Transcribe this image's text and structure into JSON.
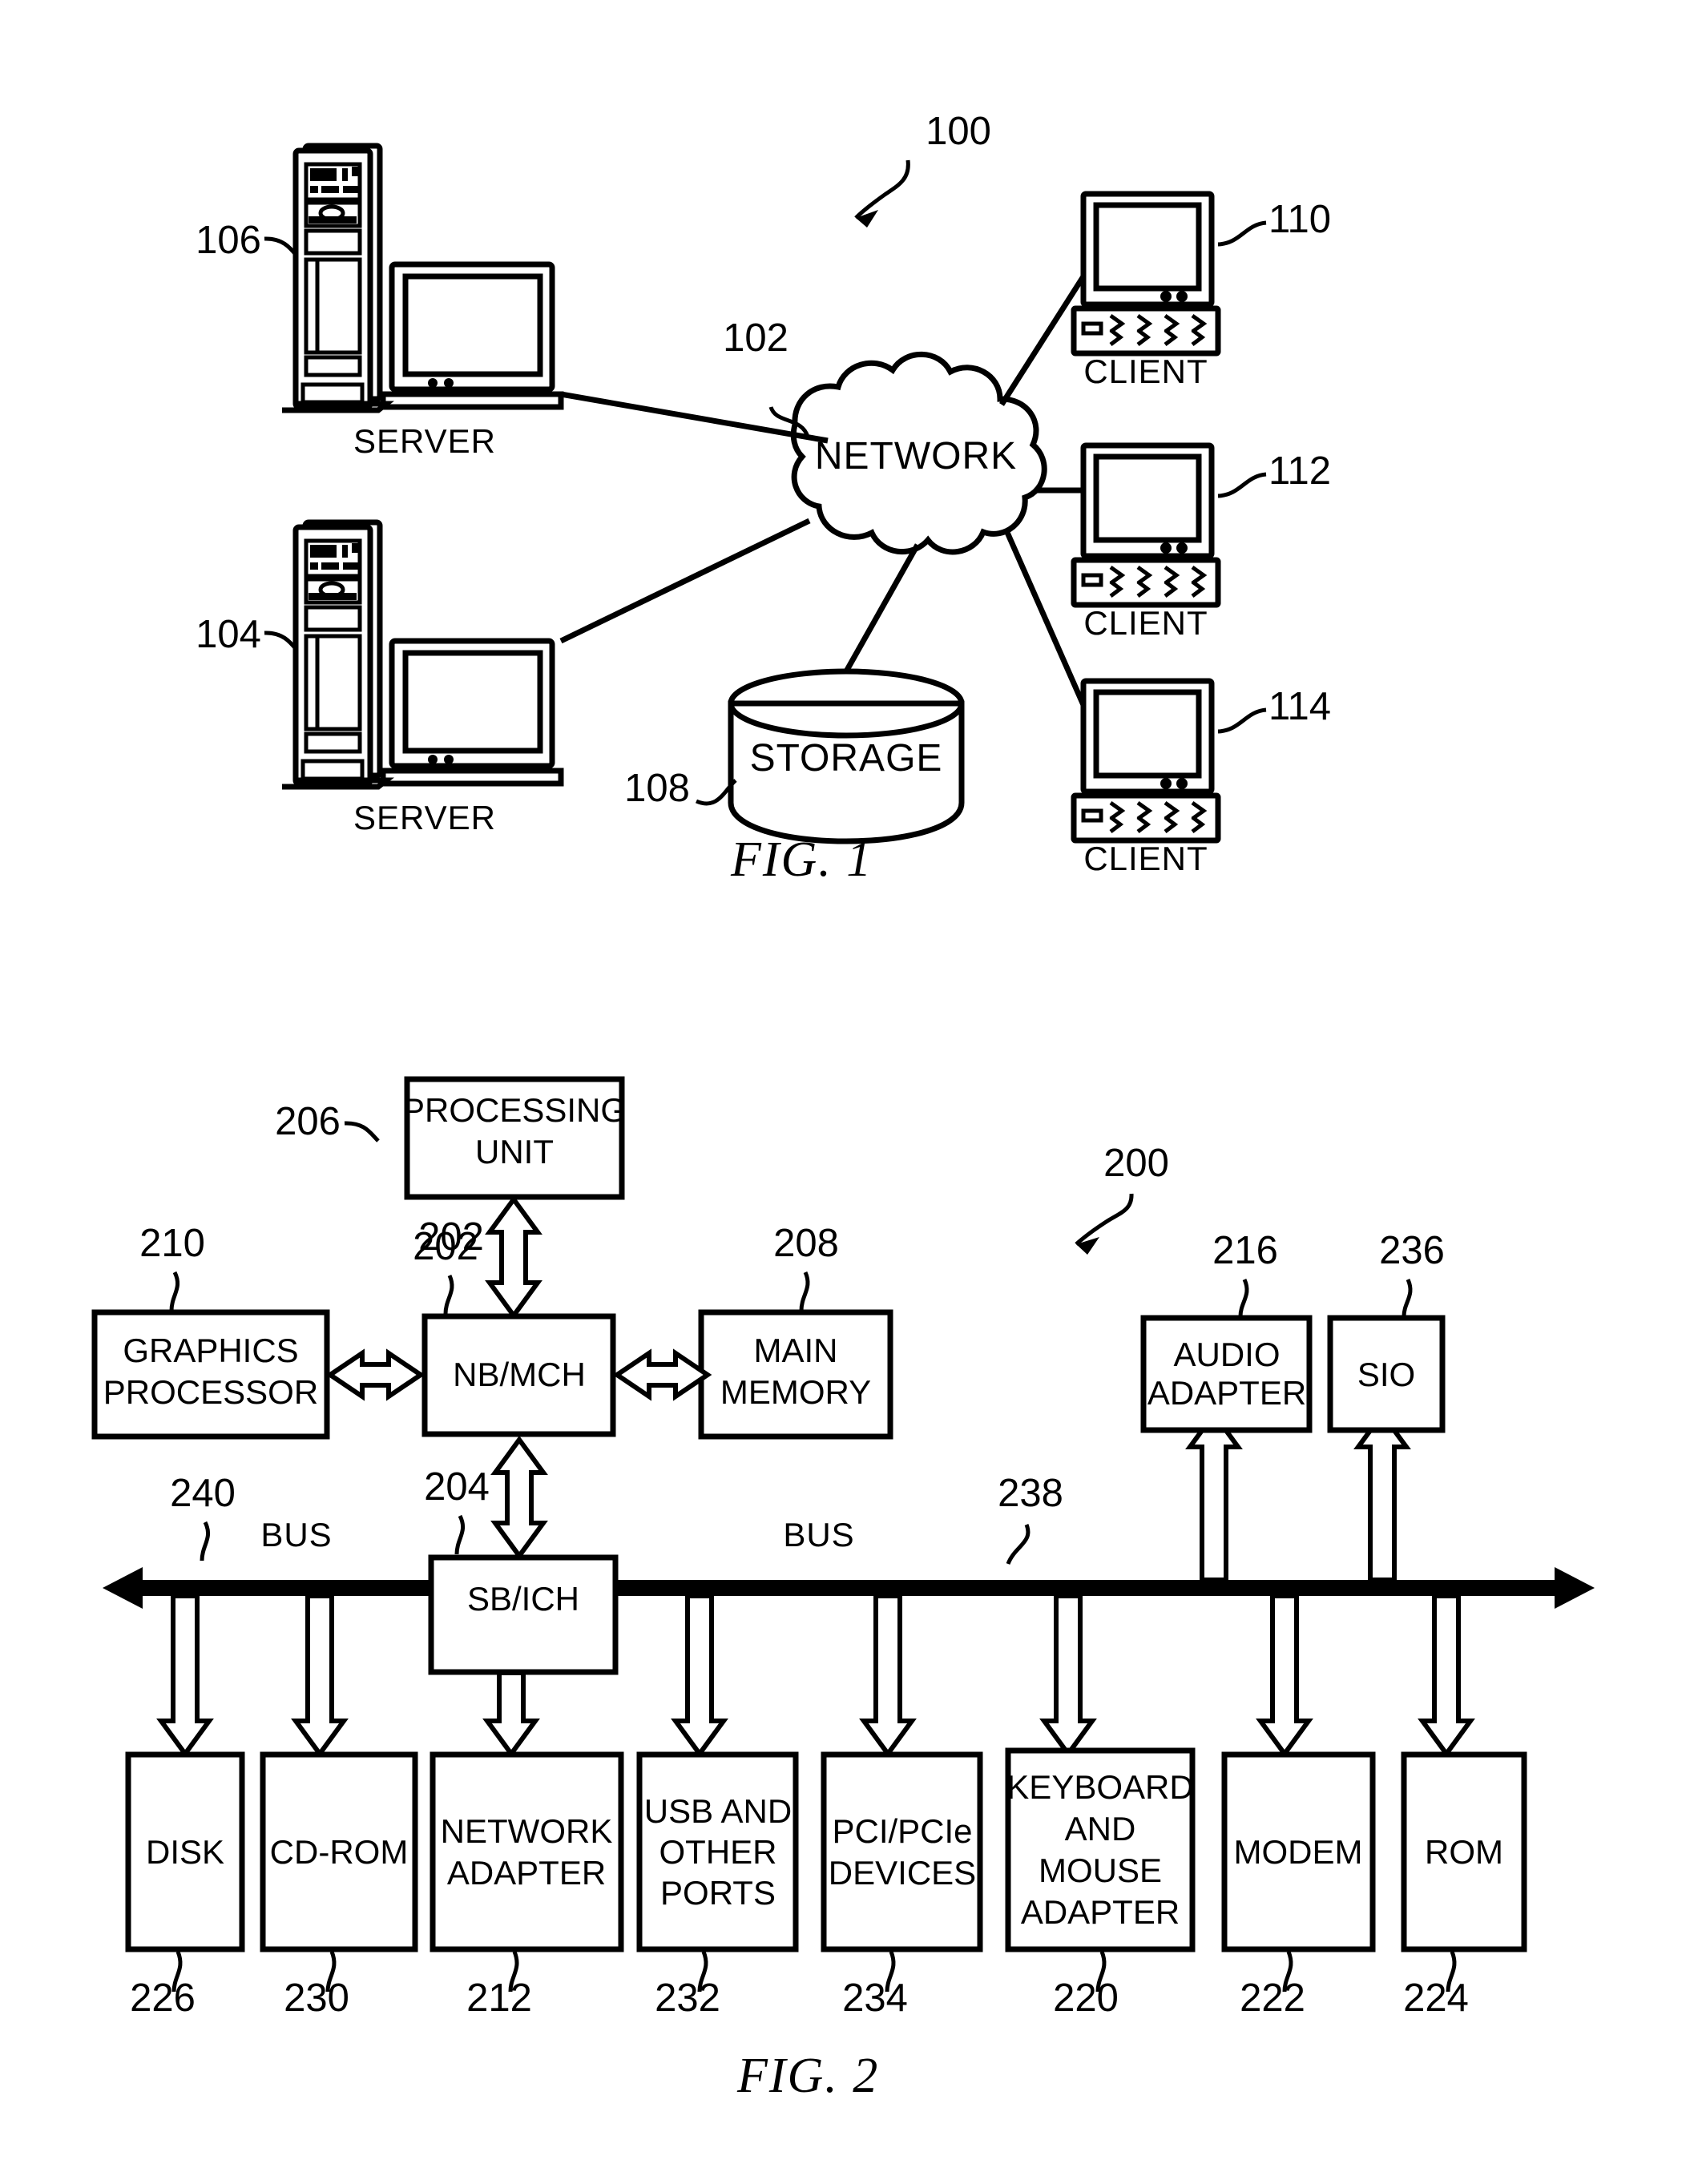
{
  "document": {
    "type": "patent-drawing-sheet",
    "figures": [
      {
        "id": "fig1",
        "caption": "FIG. 1",
        "overall_ref": "100",
        "nodes": [
          {
            "ref": "106",
            "label": "SERVER",
            "kind": "server-tower-and-monitor"
          },
          {
            "ref": "104",
            "label": "SERVER",
            "kind": "server-tower-and-monitor"
          },
          {
            "ref": "102",
            "label": "NETWORK",
            "kind": "cloud"
          },
          {
            "ref": "108",
            "label": "STORAGE",
            "kind": "cylinder"
          },
          {
            "ref": "110",
            "label": "CLIENT",
            "kind": "desktop-computer"
          },
          {
            "ref": "112",
            "label": "CLIENT",
            "kind": "desktop-computer"
          },
          {
            "ref": "114",
            "label": "CLIENT",
            "kind": "desktop-computer"
          }
        ]
      },
      {
        "id": "fig2",
        "caption": "FIG. 2",
        "overall_ref": "200",
        "bus_labels": [
          {
            "ref": "240",
            "label": "BUS"
          },
          {
            "ref": "238",
            "label": "BUS"
          }
        ],
        "blocks": [
          {
            "ref": "206",
            "label": "PROCESSING UNIT",
            "lines": [
              "PROCESSING",
              "UNIT"
            ]
          },
          {
            "ref": "202",
            "label": "NB/MCH",
            "lines": [
              "NB/MCH"
            ]
          },
          {
            "ref": "210",
            "label": "GRAPHICS PROCESSOR",
            "lines": [
              "GRAPHICS",
              "PROCESSOR"
            ]
          },
          {
            "ref": "208",
            "label": "MAIN MEMORY",
            "lines": [
              "MAIN",
              "MEMORY"
            ]
          },
          {
            "ref": "216",
            "label": "AUDIO ADAPTER",
            "lines": [
              "AUDIO",
              "ADAPTER"
            ]
          },
          {
            "ref": "236",
            "label": "SIO",
            "lines": [
              "SIO"
            ]
          },
          {
            "ref": "204",
            "label": "SB/ICH",
            "lines": [
              "SB/ICH"
            ]
          },
          {
            "ref": "226",
            "label": "DISK",
            "lines": [
              "DISK"
            ]
          },
          {
            "ref": "230",
            "label": "CD-ROM",
            "lines": [
              "CD-ROM"
            ]
          },
          {
            "ref": "212",
            "label": "NETWORK ADAPTER",
            "lines": [
              "NETWORK",
              "ADAPTER"
            ]
          },
          {
            "ref": "232",
            "label": "USB AND OTHER PORTS",
            "lines": [
              "USB AND",
              "OTHER",
              "PORTS"
            ]
          },
          {
            "ref": "234",
            "label": "PCI/PCIe DEVICES",
            "lines": [
              "PCI/PCIe",
              "DEVICES"
            ]
          },
          {
            "ref": "220",
            "label": "KEYBOARD AND MOUSE ADAPTER",
            "lines": [
              "KEYBOARD",
              "AND",
              "MOUSE",
              "ADAPTER"
            ]
          },
          {
            "ref": "222",
            "label": "MODEM",
            "lines": [
              "MODEM"
            ]
          },
          {
            "ref": "224",
            "label": "ROM",
            "lines": [
              "ROM"
            ]
          }
        ]
      }
    ]
  },
  "fig1": {
    "caption": "FIG. 1",
    "ref_100": "100",
    "ref_106": "106",
    "ref_104": "104",
    "ref_102": "102",
    "ref_108": "108",
    "ref_110": "110",
    "ref_112": "112",
    "ref_114": "114",
    "label_server_top": "SERVER",
    "label_server_bottom": "SERVER",
    "label_network": "NETWORK",
    "label_storage": "STORAGE",
    "label_client_1": "CLIENT",
    "label_client_2": "CLIENT",
    "label_client_3": "CLIENT"
  },
  "fig2": {
    "caption": "FIG. 2",
    "ref_200": "200",
    "ref_206": "206",
    "ref_202a": "202",
    "ref_202b": "202",
    "ref_210": "210",
    "ref_208": "208",
    "ref_216": "216",
    "ref_236": "236",
    "ref_204": "204",
    "ref_240": "240",
    "ref_238": "238",
    "ref_226": "226",
    "ref_230": "230",
    "ref_212": "212",
    "ref_232": "232",
    "ref_234": "234",
    "ref_220": "220",
    "ref_222": "222",
    "ref_224": "224",
    "pu_l1": "PROCESSING",
    "pu_l2": "UNIT",
    "nbmch": "NB/MCH",
    "gp_l1": "GRAPHICS",
    "gp_l2": "PROCESSOR",
    "mm_l1": "MAIN",
    "mm_l2": "MEMORY",
    "aa_l1": "AUDIO",
    "aa_l2": "ADAPTER",
    "sio": "SIO",
    "sbich": "SB/ICH",
    "bus_left": "BUS",
    "bus_right": "BUS",
    "disk": "DISK",
    "cdrom": "CD-ROM",
    "na_l1": "NETWORK",
    "na_l2": "ADAPTER",
    "usb_l1": "USB AND",
    "usb_l2": "OTHER",
    "usb_l3": "PORTS",
    "pci_l1": "PCI/PCIe",
    "pci_l2": "DEVICES",
    "km_l1": "KEYBOARD",
    "km_l2": "AND",
    "km_l3": "MOUSE",
    "km_l4": "ADAPTER",
    "modem": "MODEM",
    "rom": "ROM"
  }
}
